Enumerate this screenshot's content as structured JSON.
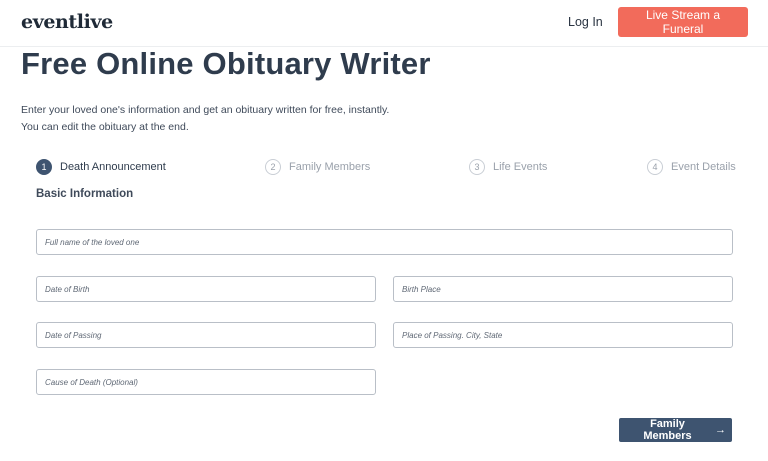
{
  "header": {
    "logo": "eventlive",
    "login": "Log In",
    "cta": "Live Stream a Funeral",
    "cta_color": "#f26b5b"
  },
  "page": {
    "title": "Free Online Obituary Writer",
    "intro_line1": "Enter your loved one's information and get an obituary written for free, instantly.",
    "intro_line2": "You can edit the obituary at the end."
  },
  "steps": [
    {
      "num": "1",
      "label": "Death Announcement",
      "active": true
    },
    {
      "num": "2",
      "label": "Family Members",
      "active": false
    },
    {
      "num": "3",
      "label": "Life Events",
      "active": false
    },
    {
      "num": "4",
      "label": "Event Details",
      "active": false
    }
  ],
  "form": {
    "section": "Basic Information",
    "full_name": {
      "placeholder": "Full name of the loved one",
      "value": ""
    },
    "dob": {
      "placeholder": "Date of Birth",
      "value": ""
    },
    "birth_place": {
      "placeholder": "Birth Place",
      "value": ""
    },
    "date_passing": {
      "placeholder": "Date of Passing",
      "value": ""
    },
    "place_passing": {
      "placeholder": "Place of Passing. City, State",
      "value": ""
    },
    "cause": {
      "placeholder": "Cause of Death (Optional)",
      "value": ""
    }
  },
  "next_button": {
    "label": "Family Members",
    "icon": "arrow-right-icon",
    "color": "#3e5470"
  }
}
